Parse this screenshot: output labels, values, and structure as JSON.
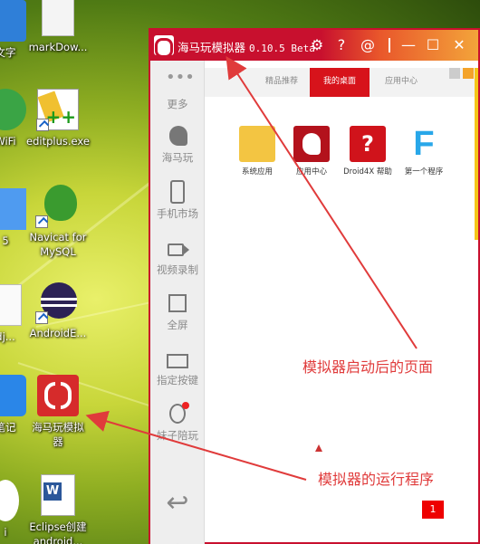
{
  "desktop": {
    "icons": [
      {
        "label": "文字",
        "icon": "blue-doc-icon"
      },
      {
        "label": "markDow...",
        "icon": "file-icon"
      },
      {
        "label": "WiFi",
        "icon": "wifi-app-icon"
      },
      {
        "label": "editplus.exe",
        "icon": "editplus-icon"
      },
      {
        "label": "5",
        "icon": "blue-app-icon"
      },
      {
        "label": "Navicat for\nMySQL",
        "icon": "navicat-icon"
      },
      {
        "label": "dj...",
        "icon": "file-icon"
      },
      {
        "label": "AndroidE...",
        "icon": "eclipse-icon"
      },
      {
        "label": "笔记",
        "icon": "note-app-icon"
      },
      {
        "label": "海马玩模拟\n器",
        "icon": "haimawan-icon"
      },
      {
        "label": "i",
        "icon": "chat-app-icon"
      },
      {
        "label": "Eclipse创建\nandroid...",
        "icon": "word-doc-icon"
      }
    ]
  },
  "window": {
    "title": "海马玩模拟器",
    "version": "0.10.5 Beta",
    "buttons": {
      "minimize": "—",
      "maximize": "☐",
      "close": "✕"
    },
    "sidebar": [
      {
        "label": "更多",
        "icon": "more-dots-icon"
      },
      {
        "label": "海马玩",
        "icon": "seahorse-icon"
      },
      {
        "label": "手机市场",
        "icon": "phone-market-icon"
      },
      {
        "label": "视频录制",
        "icon": "video-camera-icon"
      },
      {
        "label": "全屏",
        "icon": "fullscreen-icon"
      },
      {
        "label": "指定按键",
        "icon": "keyboard-icon"
      },
      {
        "label": "妹子陪玩",
        "icon": "girl-avatar-icon"
      },
      {
        "label": "",
        "icon": "back-arrow-icon"
      },
      {
        "label": "",
        "icon": "home-icon"
      }
    ],
    "tabs": [
      {
        "label": "精品推荐",
        "active": false
      },
      {
        "label": "我的桌面",
        "active": true
      },
      {
        "label": "应用中心",
        "active": false
      }
    ],
    "apps": [
      {
        "label": "系统应用",
        "icon": "folder-icon"
      },
      {
        "label": "应用中心",
        "icon": "app-center-icon"
      },
      {
        "label": "Droid4X 帮助",
        "icon": "help-icon"
      },
      {
        "label": "第一个程序",
        "icon": "f-app-icon"
      }
    ],
    "badge": "1"
  },
  "annotations": {
    "page_label": "模拟器启动后的页面",
    "program_label": "模拟器的运行程序"
  },
  "colors": {
    "brand_red": "#c8102e",
    "tab_active": "#d7131b",
    "annotation": "#e03b3b"
  }
}
